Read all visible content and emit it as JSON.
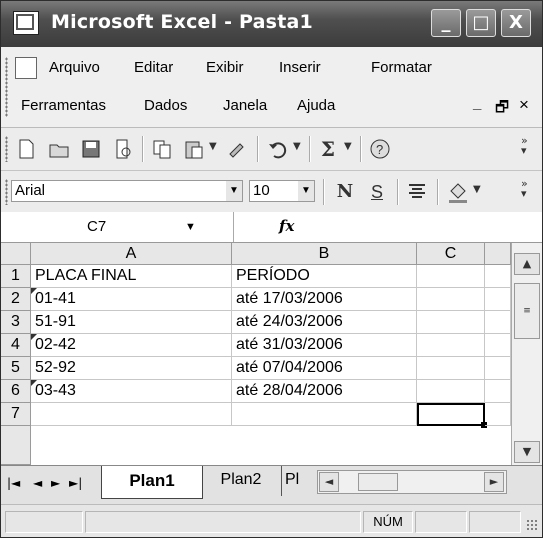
{
  "window": {
    "title": "Microsoft Excel - Pasta1",
    "minimize": "_",
    "restore": "□",
    "close": "X"
  },
  "menu": {
    "row1": [
      "Arquivo",
      "Editar",
      "Exibir",
      "Inserir",
      "Formatar"
    ],
    "row2": [
      "Ferramentas",
      "Dados",
      "Janela",
      "Ajuda"
    ],
    "doc_minimize": "_",
    "doc_restore": "🗗",
    "doc_close": "×"
  },
  "toolbar": {
    "icons": [
      "new-document-icon",
      "open-folder-icon",
      "save-icon",
      "print-preview-icon",
      "copy-icon",
      "paste-icon",
      "format-painter-icon",
      "undo-icon",
      "autosum-icon",
      "help-icon"
    ],
    "sigma": "Σ"
  },
  "format": {
    "font": "Arial",
    "size": "10",
    "bold": "N",
    "underline": "S"
  },
  "formula": {
    "cell_ref": "C7",
    "fx": "fx",
    "value": ""
  },
  "sheet": {
    "columns": [
      "A",
      "B",
      "C"
    ],
    "rows": [
      "1",
      "2",
      "3",
      "4",
      "5",
      "6",
      "7"
    ],
    "cells": [
      [
        "PLACA FINAL",
        "PERÍODO",
        ""
      ],
      [
        "01-41",
        "até 17/03/2006",
        ""
      ],
      [
        "51-91",
        "até 24/03/2006",
        ""
      ],
      [
        "02-42",
        "até 31/03/2006",
        ""
      ],
      [
        "52-92",
        "até 07/04/2006",
        ""
      ],
      [
        "03-43",
        "até 28/04/2006",
        ""
      ],
      [
        "",
        "",
        ""
      ]
    ],
    "selected_cell": "C7"
  },
  "tabs": {
    "active": "Plan1",
    "others": [
      "Plan2",
      "Pl"
    ]
  },
  "status": {
    "num": "NÚM"
  }
}
